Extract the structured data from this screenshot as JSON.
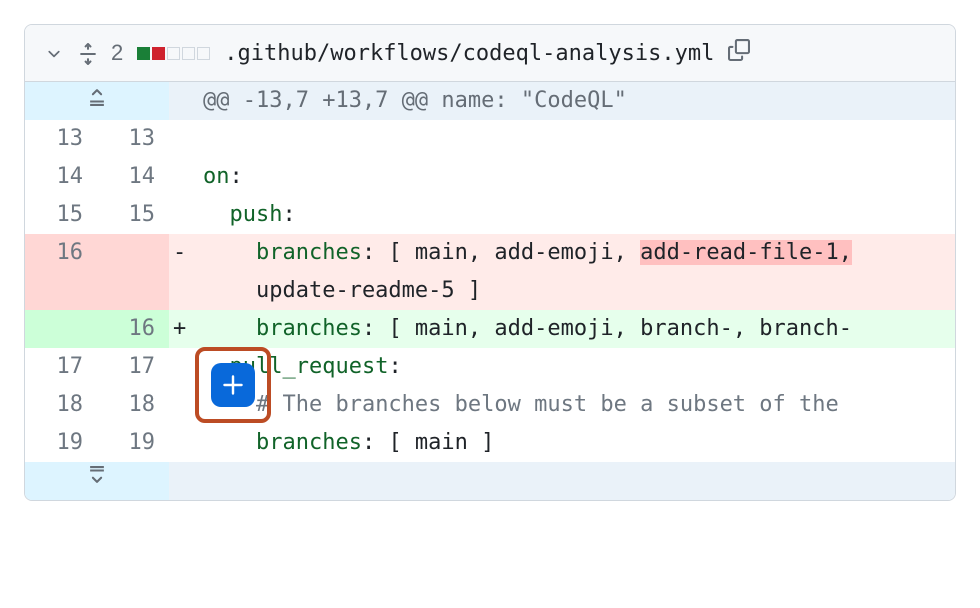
{
  "header": {
    "change_count": "2",
    "file_path": ".github/workflows/codeql-analysis.yml"
  },
  "hunk": {
    "header": "@@ -13,7 +13,7 @@ name: \"CodeQL\""
  },
  "lines": [
    {
      "old": "13",
      "new": "13",
      "type": "context",
      "marker": "",
      "content": ""
    },
    {
      "old": "14",
      "new": "14",
      "type": "context",
      "marker": "",
      "key": "on",
      "rest": ":"
    },
    {
      "old": "15",
      "new": "15",
      "type": "context",
      "marker": "",
      "indent": "  ",
      "key": "push",
      "rest": ":"
    },
    {
      "old": "16",
      "new": "",
      "type": "deletion",
      "marker": "-",
      "indent": "    ",
      "key": "branches",
      "rest": ": [ main, add-emoji, ",
      "deleted_span": "add-read-file-1,",
      "cont_indent": "    ",
      "cont": "update-readme-5 ]"
    },
    {
      "old": "",
      "new": "16",
      "type": "addition",
      "marker": "+",
      "indent": "    ",
      "key": "branches",
      "rest": ": [ main, add-emoji, branch-, branch-"
    },
    {
      "old": "17",
      "new": "17",
      "type": "context",
      "marker": "",
      "indent": "  ",
      "key": "pull_request",
      "rest": ":"
    },
    {
      "old": "18",
      "new": "18",
      "type": "context",
      "marker": "",
      "indent": "    ",
      "comment": "# The branches below must be a subset of the "
    },
    {
      "old": "19",
      "new": "19",
      "type": "context",
      "marker": "",
      "indent": "    ",
      "key": "branches",
      "rest": ": [ main ]"
    }
  ]
}
